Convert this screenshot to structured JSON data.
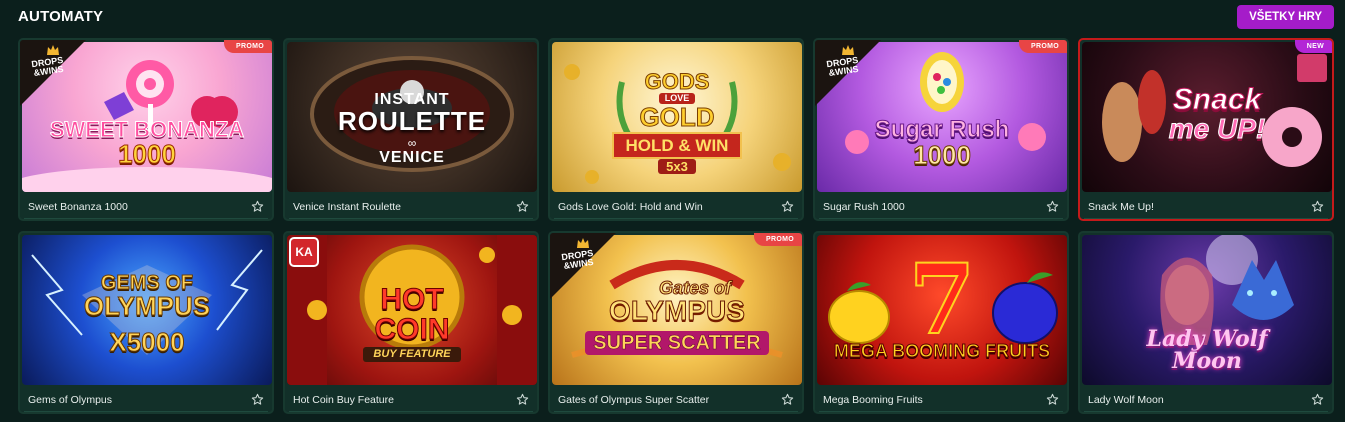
{
  "section": {
    "title": "AUTOMATY",
    "view_all_label": "VŠETKY HRY"
  },
  "badges": {
    "promo": "PROMO",
    "new": "NEW",
    "drops_line1": "DROPS",
    "drops_line2": "&WINS"
  },
  "games": [
    {
      "name": "Sweet Bonanza 1000",
      "logo_line1": "SWEET BONANZA",
      "logo_line2": "1000"
    },
    {
      "name": "Venice Instant Roulette",
      "logo_line1": "INSTANT",
      "logo_line2": "ROULETTE",
      "logo_line3": "VENICE"
    },
    {
      "name": "Gods Love Gold: Hold and Win",
      "logo_line1": "GODS",
      "logo_line2": "LOVE",
      "logo_line3": "GOLD",
      "logo_line4": "HOLD & WIN",
      "logo_line5": "5x3"
    },
    {
      "name": "Sugar Rush 1000",
      "logo_line1": "Sugar Rush",
      "logo_line2": "1000"
    },
    {
      "name": "Snack Me Up!",
      "logo_line1": "Snack",
      "logo_line2": "me UP!"
    },
    {
      "name": "Gems of Olympus",
      "logo_line1": "GEMS OF",
      "logo_line2": "OLYMPUS",
      "logo_line3": "X5000"
    },
    {
      "name": "Hot Coin Buy Feature",
      "logo_line1": "HOT",
      "logo_line2": "COIN",
      "logo_line3": "BUY FEATURE",
      "provider": "KA"
    },
    {
      "name": "Gates of Olympus Super Scatter",
      "logo_line1": "Gates of",
      "logo_line2": "OLYMPUS",
      "logo_line3": "SUPER SCATTER"
    },
    {
      "name": "Mega Booming Fruits",
      "logo_line1": "7",
      "logo_line2": "MEGA BOOMING FRUITS"
    },
    {
      "name": "Lady Wolf Moon",
      "logo_line1": "Lady Wolf",
      "logo_line2": "Moon"
    }
  ],
  "colors": {
    "background": "#0b1f1c",
    "card": "#123029",
    "accent": "#a51cc9",
    "promo": "#e84545",
    "new": "#b326d6"
  },
  "icons": {
    "favorite": "star-outline-icon"
  }
}
